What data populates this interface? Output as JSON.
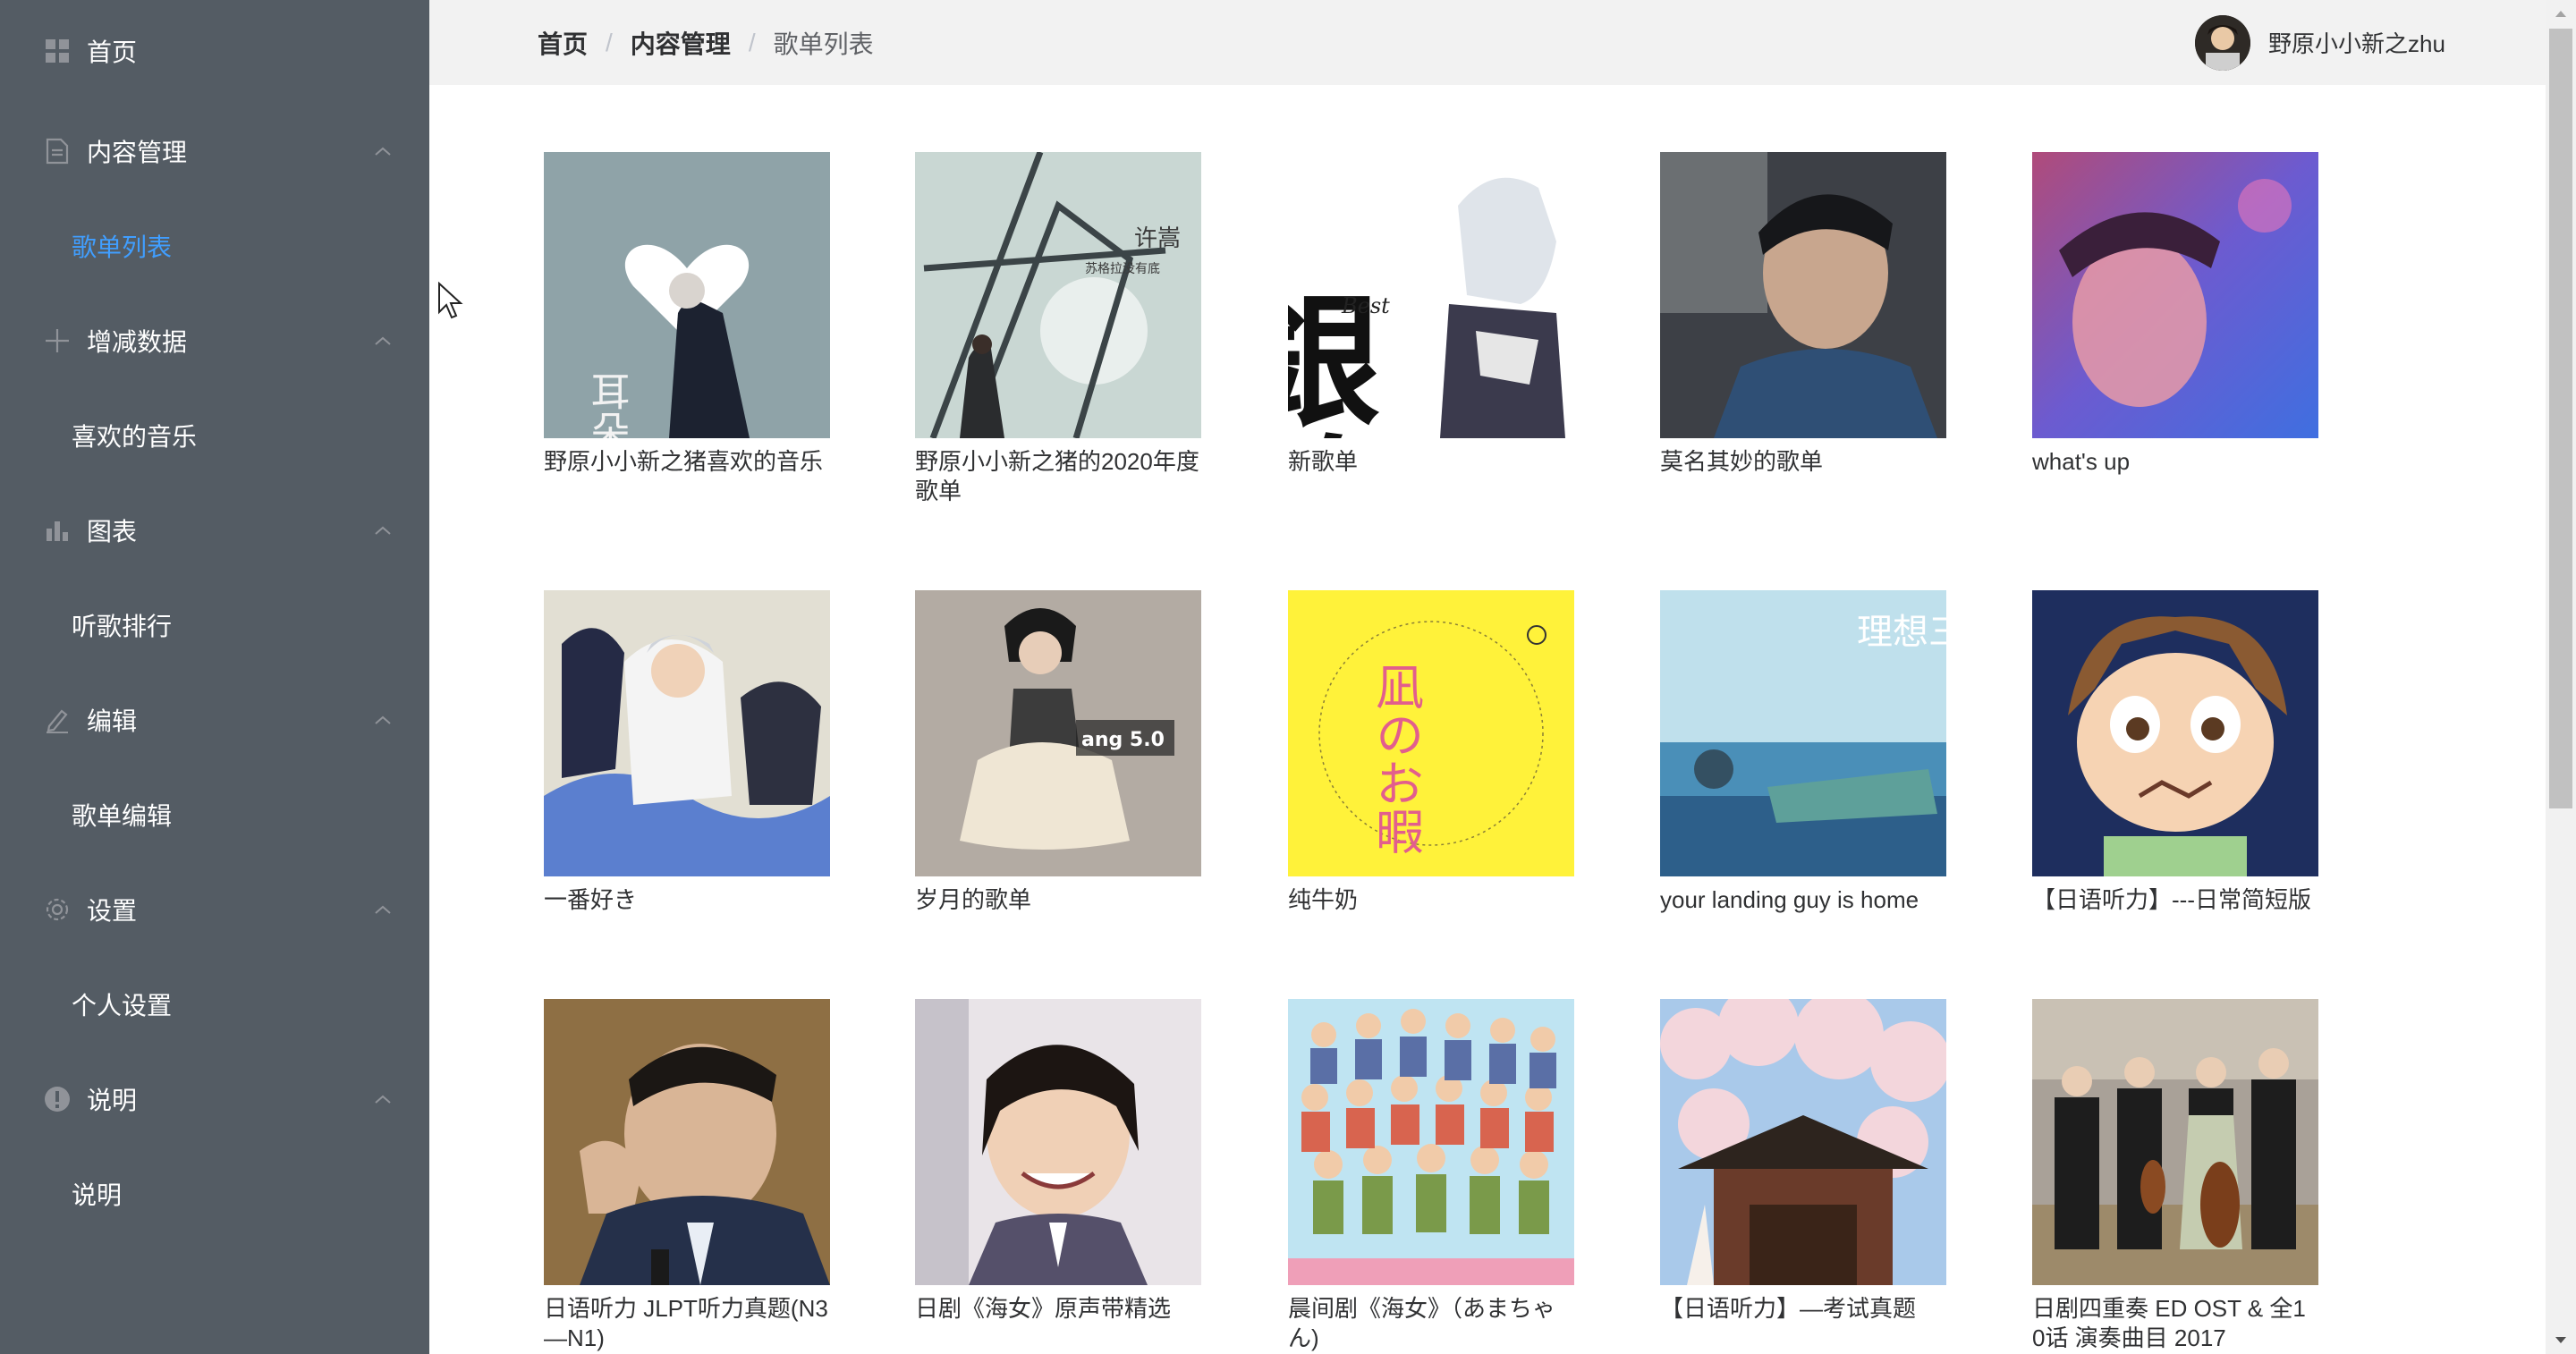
{
  "sidebar": {
    "home_label": "首页",
    "content_mgmt_label": "内容管理",
    "playlist_label": "歌单列表",
    "add_data_label": "增减数据",
    "fav_music_label": "喜欢的音乐",
    "charts_label": "图表",
    "rank_label": "听歌排行",
    "edit_label": "编辑",
    "playlist_edit_label": "歌单编辑",
    "settings_label": "设置",
    "personal_settings_label": "个人设置",
    "about_label": "说明",
    "about_sub_label": "说明",
    "active_color": "#409eff",
    "bg_color": "#545c64"
  },
  "header": {
    "breadcrumb": [
      "首页",
      "内容管理",
      "歌单列表"
    ],
    "separator": "/",
    "username": "野原小小新之zhu"
  },
  "playlists": [
    {
      "title": "野原小小新之猪喜欢的音乐"
    },
    {
      "title": "野原小小新之猪的2020年度歌单"
    },
    {
      "title": "新歌单"
    },
    {
      "title": "莫名其妙的歌单"
    },
    {
      "title": "what's up"
    },
    {
      "title": "一番好き"
    },
    {
      "title": "岁月的歌单"
    },
    {
      "title": "纯牛奶"
    },
    {
      "title": "your landing guy is home"
    },
    {
      "title": "【日语听力】---日常简短版"
    },
    {
      "title": "日语听力 JLPT听力真题(N3—N1)"
    },
    {
      "title": "日剧《海女》原声带精选"
    },
    {
      "title": "晨间剧《海女》（あまちゃん)"
    },
    {
      "title": "【日语听力】—考试真题"
    },
    {
      "title": "日剧四重奏 ED OST & 全10话 演奏曲目 2017"
    }
  ],
  "cover_text": {
    "c1": "耳朵",
    "c2_artist": "许嵩",
    "c2_sub": "苏格拉没有底",
    "c3_title": "銀魂",
    "c3_sub": "Best",
    "c7": "ang 5.0",
    "c8_title": "凪のお暇",
    "c9": "理想三旬"
  }
}
